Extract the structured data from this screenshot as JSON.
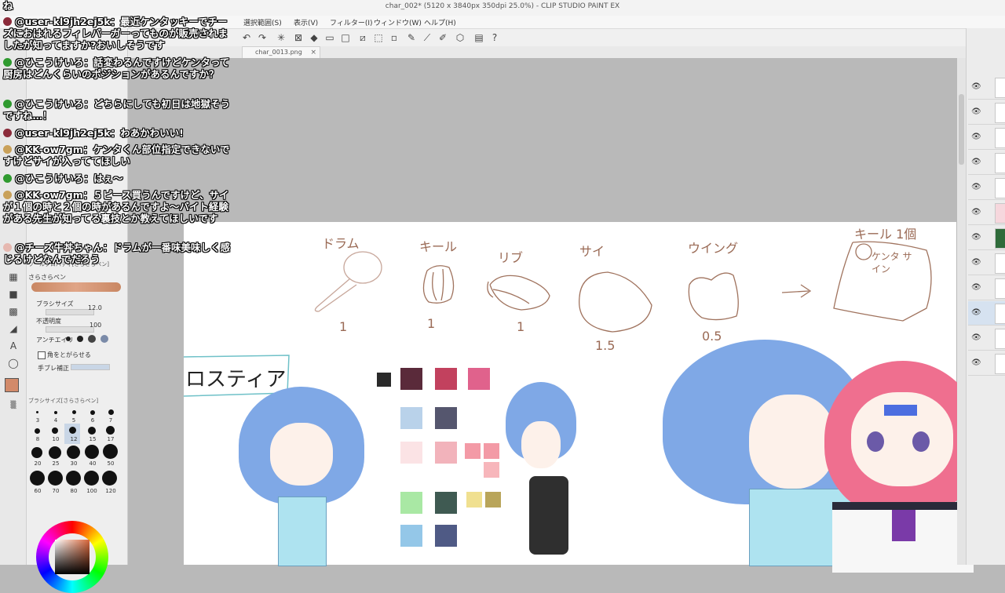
{
  "window": {
    "title": "char_002* (5120 x 3840px 350dpi 25.0%) - CLIP STUDIO PAINT EX"
  },
  "menu": {
    "items": [
      "選択範囲(S)",
      "表示(V)",
      "フィルター(I)",
      "ウィンドウ(W)",
      "ヘルプ(H)"
    ]
  },
  "tabs": [
    {
      "label": "char_0013.png"
    }
  ],
  "tool_property": {
    "panel_title": "ツールプロパティ[さらさらペン]",
    "brush_name": "さらさらペン",
    "brush_size_label": "ブラシサイズ",
    "brush_size_value": "12.0",
    "opacity_label": "不透明度",
    "opacity_value": "100",
    "antialias_label": "アンチエイリ",
    "corner_label": "角をとがらせる",
    "stabilize_label": "手ブレ補正"
  },
  "brush_size_panel": {
    "title": "ブラシサイズ[さらさらペン]",
    "sizes": [
      "3",
      "4",
      "5",
      "6",
      "7",
      "8",
      "10",
      "12",
      "15",
      "17",
      "20",
      "25",
      "30",
      "40",
      "50",
      "60",
      "70",
      "80",
      "100",
      "120"
    ]
  },
  "canvas": {
    "sketch_labels": [
      "ドラム",
      "キール",
      "リブ",
      "サイ",
      "ウイング",
      "キール 1個"
    ],
    "counts": [
      "1",
      "1",
      "1",
      "1.5",
      "0.5"
    ],
    "sketch_note": "ケンタ サイン",
    "name_label": "ロスティア"
  },
  "chat": [
    {
      "author": "",
      "text": "ね",
      "avatar_color": ""
    },
    {
      "author": "@user-kl9jh2ej5k",
      "text": "最近ケンタッキーでチーズにおはれるフィレバーガーってものが販売されましたが知ってますか?おいしそうです",
      "avatar_color": "#8b2b3a"
    },
    {
      "author": "@ひこうけいろ",
      "text": "話変わるんですけどケンタって厨房はどんくらいのポジションがあるんですか？",
      "avatar_color": "#2f9a2f"
    },
    {
      "author": "@ひこうけいろ",
      "text": "どちらにしても初日は地獄そうですね…！",
      "avatar_color": "#2f9a2f"
    },
    {
      "author": "@user-kl9jh2ej5k",
      "text": "わあかわいい!",
      "avatar_color": "#8b2b3a"
    },
    {
      "author": "@KK-ow7gm",
      "text": "ケンタくん部位指定できないですけどサイが入っててほしい",
      "avatar_color": "#c9a15a"
    },
    {
      "author": "@ひこうけいろ",
      "text": "はぇ〜",
      "avatar_color": "#2f9a2f"
    },
    {
      "author": "@KK-ow7gm",
      "text": "５ピース買うんですけど、サイが１個の時と２個の時があるんですよ〜バイト経験がある先生が知ってる裏技とか教えてほしいです",
      "avatar_color": "#c9a15a"
    },
    {
      "author": "@チーズ牛丼ちゃん",
      "text": "ドラムが一番味美味しく感じるけどなんでだろう",
      "avatar_color": "#e6b8b0"
    }
  ],
  "colors": {
    "swatches": [
      "#2a2a2a",
      "#5a2a3a",
      "#c2415e",
      "#e0628c",
      "#b9d2ea",
      "#55566e",
      "#fbe3e5",
      "#f2b3bb",
      "#f39aa6",
      "#a9e8a4",
      "#3f5a52",
      "#f0e090",
      "#b9a55a",
      "#94c7e8",
      "#4f5a85"
    ]
  }
}
